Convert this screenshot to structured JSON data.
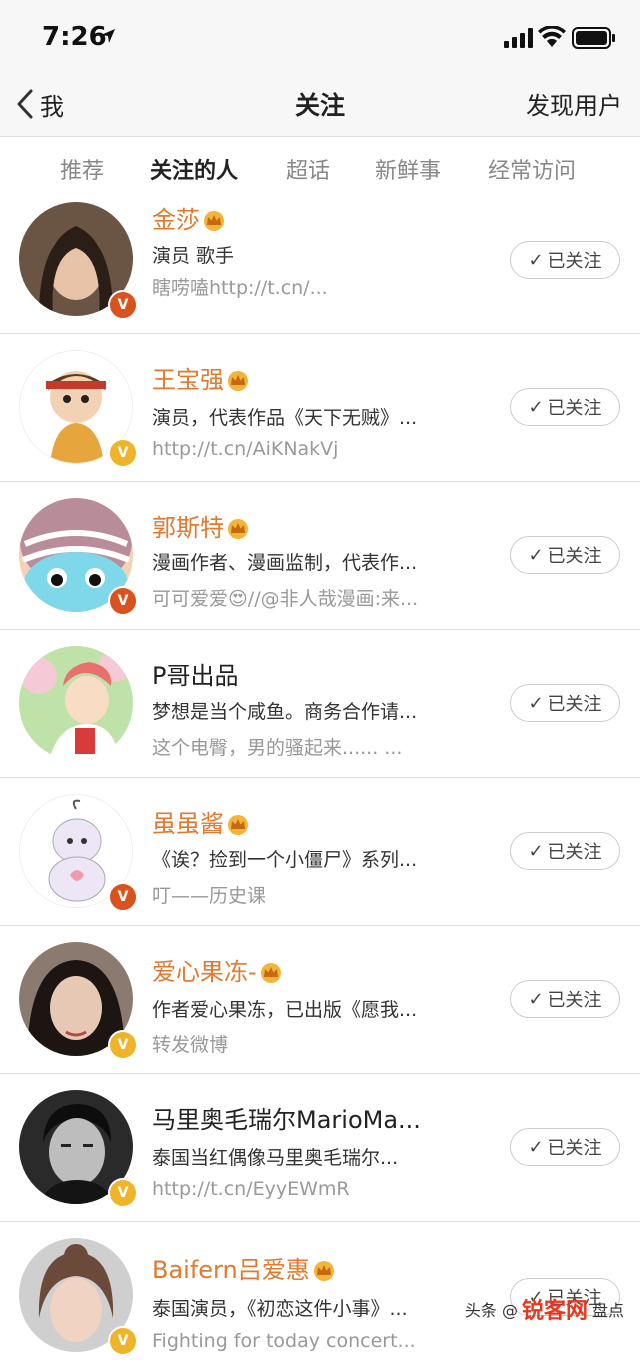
{
  "status_bar": {
    "time": "7:26"
  },
  "nav": {
    "back_label": "我",
    "title": "关注",
    "right": "发现用户"
  },
  "tabs": [
    {
      "label": "推荐"
    },
    {
      "label": "关注的人"
    },
    {
      "label": "超话"
    },
    {
      "label": "新鲜事"
    },
    {
      "label": "经常访问"
    }
  ],
  "follow_label": "已关注",
  "users": [
    {
      "name": "金莎",
      "desc": "演员 歌手",
      "sub": "瞎唠嗑http://t.cn/...",
      "badge": "red"
    },
    {
      "name": "王宝强",
      "desc": "演员，代表作品《天下无贼》...",
      "sub": "http://t.cn/AiKNakVj",
      "badge": "yellow"
    },
    {
      "name": "郭斯特",
      "desc": "漫画作者、漫画监制，代表作...",
      "sub": "可可爱爱😍//@非人哉漫画:来...",
      "badge": "red"
    },
    {
      "name": "P哥出品",
      "desc": "梦想是当个咸鱼。商务合作请...",
      "sub": "这个电臀，男的骚起来...... ...",
      "badge": "none"
    },
    {
      "name": "虽虽酱",
      "desc": "《诶？捡到一个小僵尸》系列...",
      "sub": "叮——历史课",
      "badge": "red"
    },
    {
      "name": "爱心果冻-",
      "desc": "作者爱心果冻，已出版《愿我...",
      "sub": "转发微博",
      "badge": "yellow"
    },
    {
      "name": "马里奥毛瑞尔MarioMa...",
      "desc": "泰国当红偶像马里奥毛瑞尔...",
      "sub": "http://t.cn/EyyEWmR",
      "badge": "yellow"
    },
    {
      "name": "Baifern吕爱惠",
      "desc": "泰国演员，《初恋这件小事》...",
      "sub": "Fighting for today concert...",
      "badge": "yellow"
    }
  ],
  "badge_glyph": "V",
  "watermark": {
    "left": "头条 @",
    "logo": "锐客网",
    "right": "盘点"
  },
  "colors": {
    "accent": "#ff8200",
    "vip_name": "#e2792c",
    "badge_red": "#d9531e",
    "badge_yellow": "#f0b429"
  }
}
